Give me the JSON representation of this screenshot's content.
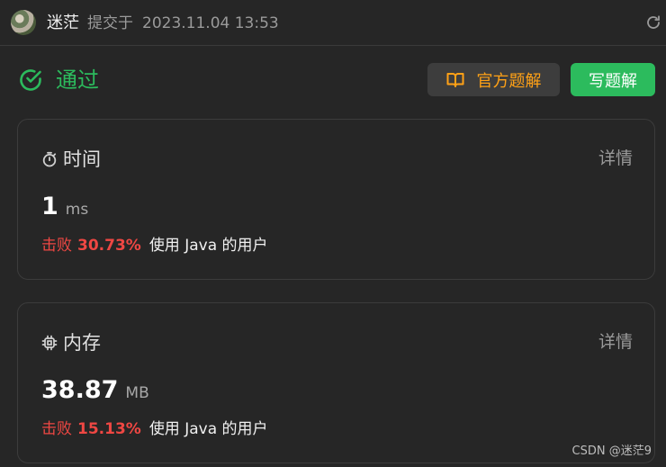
{
  "header": {
    "username": "迷茫",
    "submit_label": "提交于",
    "submit_time": "2023.11.04 13:53"
  },
  "status": {
    "text": "通过",
    "color": "#2cbb5d"
  },
  "buttons": {
    "official_solution": "官方题解",
    "write_solution": "写题解"
  },
  "time_card": {
    "title": "时间",
    "detail": "详情",
    "value": "1",
    "unit": "ms",
    "beats_label": "击败",
    "beats_percent": "30.73%",
    "beats_suffix": "使用 Java 的用户"
  },
  "memory_card": {
    "title": "内存",
    "detail": "详情",
    "value": "38.87",
    "unit": "MB",
    "beats_label": "击败",
    "beats_percent": "15.13%",
    "beats_suffix": "使用 Java 的用户"
  },
  "watermark": "CSDN @迷茫9",
  "colors": {
    "accent_green": "#2cbb5d",
    "accent_orange": "#ffa116",
    "beats_red": "#ef4743"
  }
}
